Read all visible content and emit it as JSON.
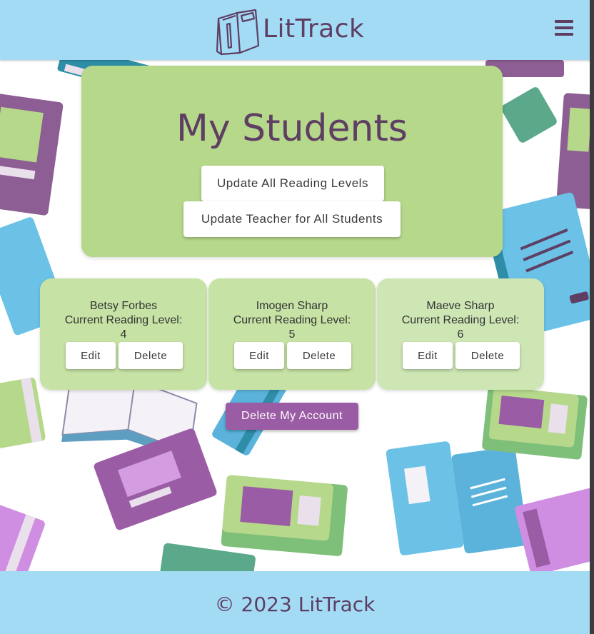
{
  "app": {
    "brand": "LitTrack"
  },
  "colors": {
    "header_bg": "#a3dbf5",
    "hero_bg": "#b6d88b",
    "card_bg": "#c6e2a4",
    "brand_purple": "#5e3e63",
    "danger_button": "#9a5ca4"
  },
  "icons": {
    "logo": "book-logo-icon",
    "menu": "hamburger-menu-icon"
  },
  "hero": {
    "title": "My Students",
    "update_levels_label": "Update All Reading Levels",
    "update_teacher_label": "Update Teacher for All Students"
  },
  "students": [
    {
      "name": "Betsy Forbes",
      "level_label": "Current Reading Level:",
      "level": "4",
      "edit_label": "Edit",
      "delete_label": "Delete"
    },
    {
      "name": "Imogen Sharp",
      "level_label": "Current Reading Level:",
      "level": "5",
      "edit_label": "Edit",
      "delete_label": "Delete"
    },
    {
      "name": "Maeve Sharp",
      "level_label": "Current Reading Level:",
      "level": "6",
      "edit_label": "Edit",
      "delete_label": "Delete"
    }
  ],
  "account": {
    "delete_label": "Delete My Account"
  },
  "footer": {
    "text": "© 2023 LitTrack"
  }
}
